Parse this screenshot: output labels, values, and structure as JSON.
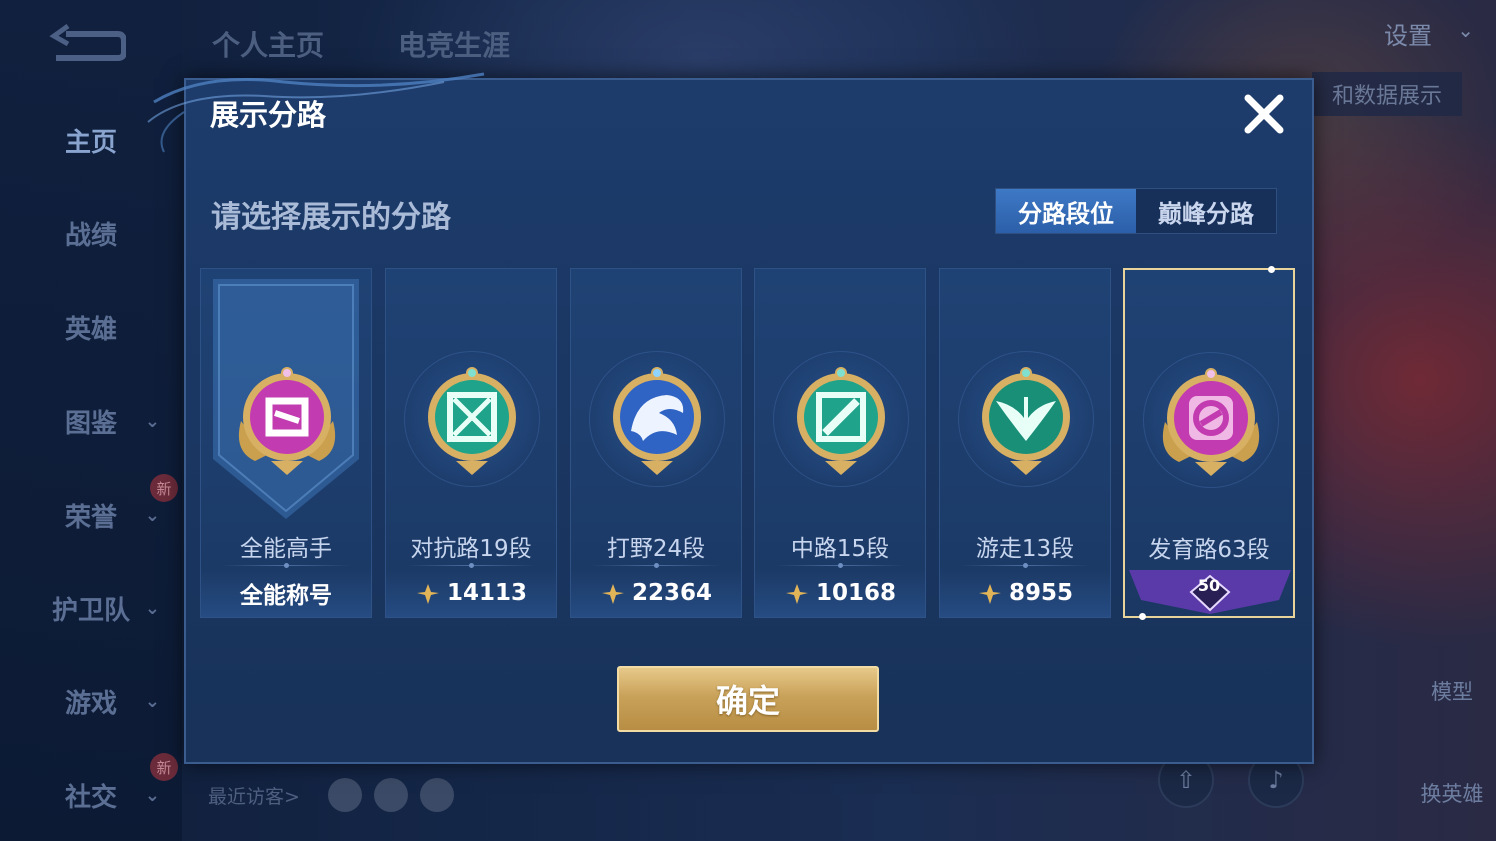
{
  "background": {
    "top_tabs": [
      "个人主页",
      "电竞生涯"
    ],
    "settings_label": "设置",
    "data_display_label": "和数据展示",
    "sidebar": [
      {
        "label": "主页",
        "active": true
      },
      {
        "label": "战绩"
      },
      {
        "label": "英雄"
      },
      {
        "label": "图鉴",
        "expandable": true
      },
      {
        "label": "荣誉",
        "expandable": true,
        "badge": "新"
      },
      {
        "label": "护卫队",
        "expandable": true
      },
      {
        "label": "游戏",
        "expandable": true
      },
      {
        "label": "社交",
        "expandable": true,
        "badge": "新"
      }
    ],
    "recent_visitors_label": "最近访客>",
    "model_label": "模型",
    "switch_hero_label": "换英雄"
  },
  "dialog": {
    "title": "展示分路",
    "subtitle": "请选择展示的分路",
    "close_icon": "close-icon",
    "segment": {
      "options": [
        "分路段位",
        "巅峰分路"
      ],
      "selected": "分路段位"
    },
    "cards": [
      {
        "name": "全能高手",
        "footer": "全能称号",
        "emblem": "all-round-emblem",
        "color": "#c33bb0",
        "banner": true
      },
      {
        "name": "对抗路19段",
        "footer": "14113",
        "emblem": "clash-lane-emblem",
        "color": "#1fa38a"
      },
      {
        "name": "打野24段",
        "footer": "22364",
        "emblem": "jungle-emblem",
        "color": "#2f63c4"
      },
      {
        "name": "中路15段",
        "footer": "10168",
        "emblem": "mid-lane-emblem",
        "color": "#1fa38a"
      },
      {
        "name": "游走13段",
        "footer": "8955",
        "emblem": "roam-emblem",
        "color": "#1a8f78"
      },
      {
        "name": "发育路63段",
        "footer": "50",
        "emblem": "farm-lane-emblem",
        "color": "#c33bb0",
        "selected": true
      }
    ],
    "confirm_label": "确定"
  }
}
